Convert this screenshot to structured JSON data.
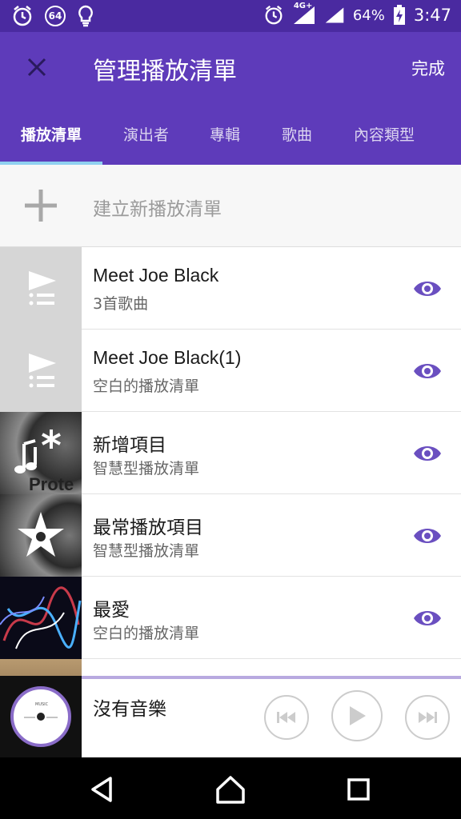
{
  "status_bar": {
    "notification_count": "64",
    "network": "4G+",
    "battery": "64%",
    "time": "3:47"
  },
  "app_bar": {
    "title": "管理播放清單",
    "done_label": "完成"
  },
  "tabs": [
    {
      "label": "播放清單",
      "active": true
    },
    {
      "label": "演出者",
      "active": false
    },
    {
      "label": "專輯",
      "active": false
    },
    {
      "label": "歌曲",
      "active": false
    },
    {
      "label": "內容類型",
      "active": false
    }
  ],
  "create": {
    "label": "建立新播放清單"
  },
  "playlists": [
    {
      "title": "Meet Joe Black",
      "subtitle": "3首歌曲"
    },
    {
      "title": "Meet Joe Black(1)",
      "subtitle": "空白的播放清單"
    },
    {
      "title": "新增項目",
      "subtitle": "智慧型播放清單"
    },
    {
      "title": "最常播放項目",
      "subtitle": "智慧型播放清單"
    },
    {
      "title": "最愛",
      "subtitle": "空白的播放清單"
    }
  ],
  "thumb_labels": {
    "record_text": "Prote"
  },
  "player": {
    "title": "沒有音樂",
    "disc_label": "MUSIC"
  },
  "colors": {
    "status_bar": "#4a2aa0",
    "app_bar": "#5e3bba",
    "accent": "#6a4fc0",
    "tab_indicator": "#8fd0f0"
  }
}
